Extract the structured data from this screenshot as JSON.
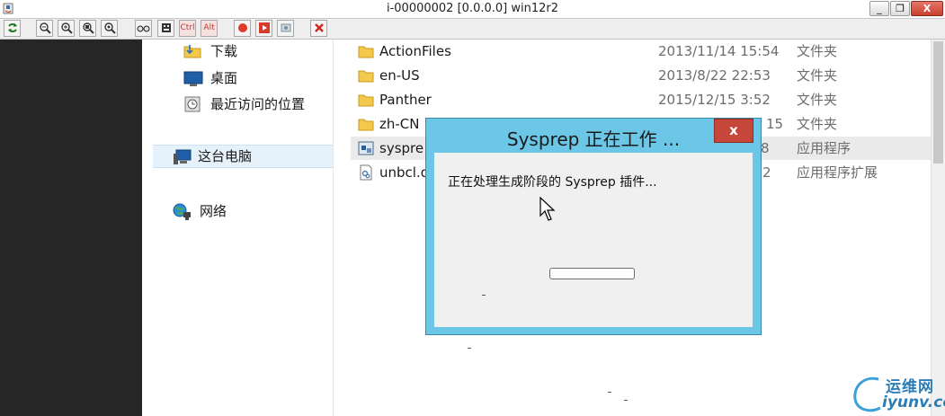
{
  "window": {
    "title": "i-00000002 [0.0.0.0] win12r2",
    "minimize_glyph": "_",
    "restore_glyph": "❐",
    "close_glyph": "X"
  },
  "toolbar": {
    "ctrl_label": "Ctrl",
    "alt_label": "Alt",
    "icons": [
      "refresh-icon",
      "zoom-out-icon",
      "zoom-in-icon",
      "zoom-fit-icon",
      "zoom-actual-icon",
      "glasses-icon",
      "keyboard-icon",
      "record-icon",
      "play-icon",
      "screenshot-icon",
      "disconnect-icon"
    ]
  },
  "nav": {
    "downloads": "下载",
    "desktop": "桌面",
    "recent": "最近访问的位置",
    "this_pc": "这台电脑",
    "network": "网络"
  },
  "files": [
    {
      "name": "ActionFiles",
      "date": "2013/11/14 15:54",
      "type": "文件夹"
    },
    {
      "name": "en-US",
      "date": "2013/8/22 22:53",
      "type": "文件夹"
    },
    {
      "name": "Panther",
      "date": "2015/12/15 3:52",
      "type": "文件夹"
    },
    {
      "name": "zh-CN",
      "date": "15",
      "type": "文件夹"
    },
    {
      "name": "syspre",
      "date": "8",
      "type": "应用程序"
    },
    {
      "name": "unbcl.d",
      "date": "2",
      "type": "应用程序扩展"
    }
  ],
  "dialog": {
    "title": "Sysprep 正在工作 ...",
    "message": "正在处理生成阶段的 Sysprep 插件...",
    "close_label": "x",
    "progress": 0
  },
  "watermark": {
    "cn": "运维网",
    "en": "iyunv.com"
  },
  "colors": {
    "dialog_frame": "#6cc6e6",
    "close_red": "#c7463a",
    "folder": "#f2c94c",
    "dark_strip": "#262626"
  }
}
